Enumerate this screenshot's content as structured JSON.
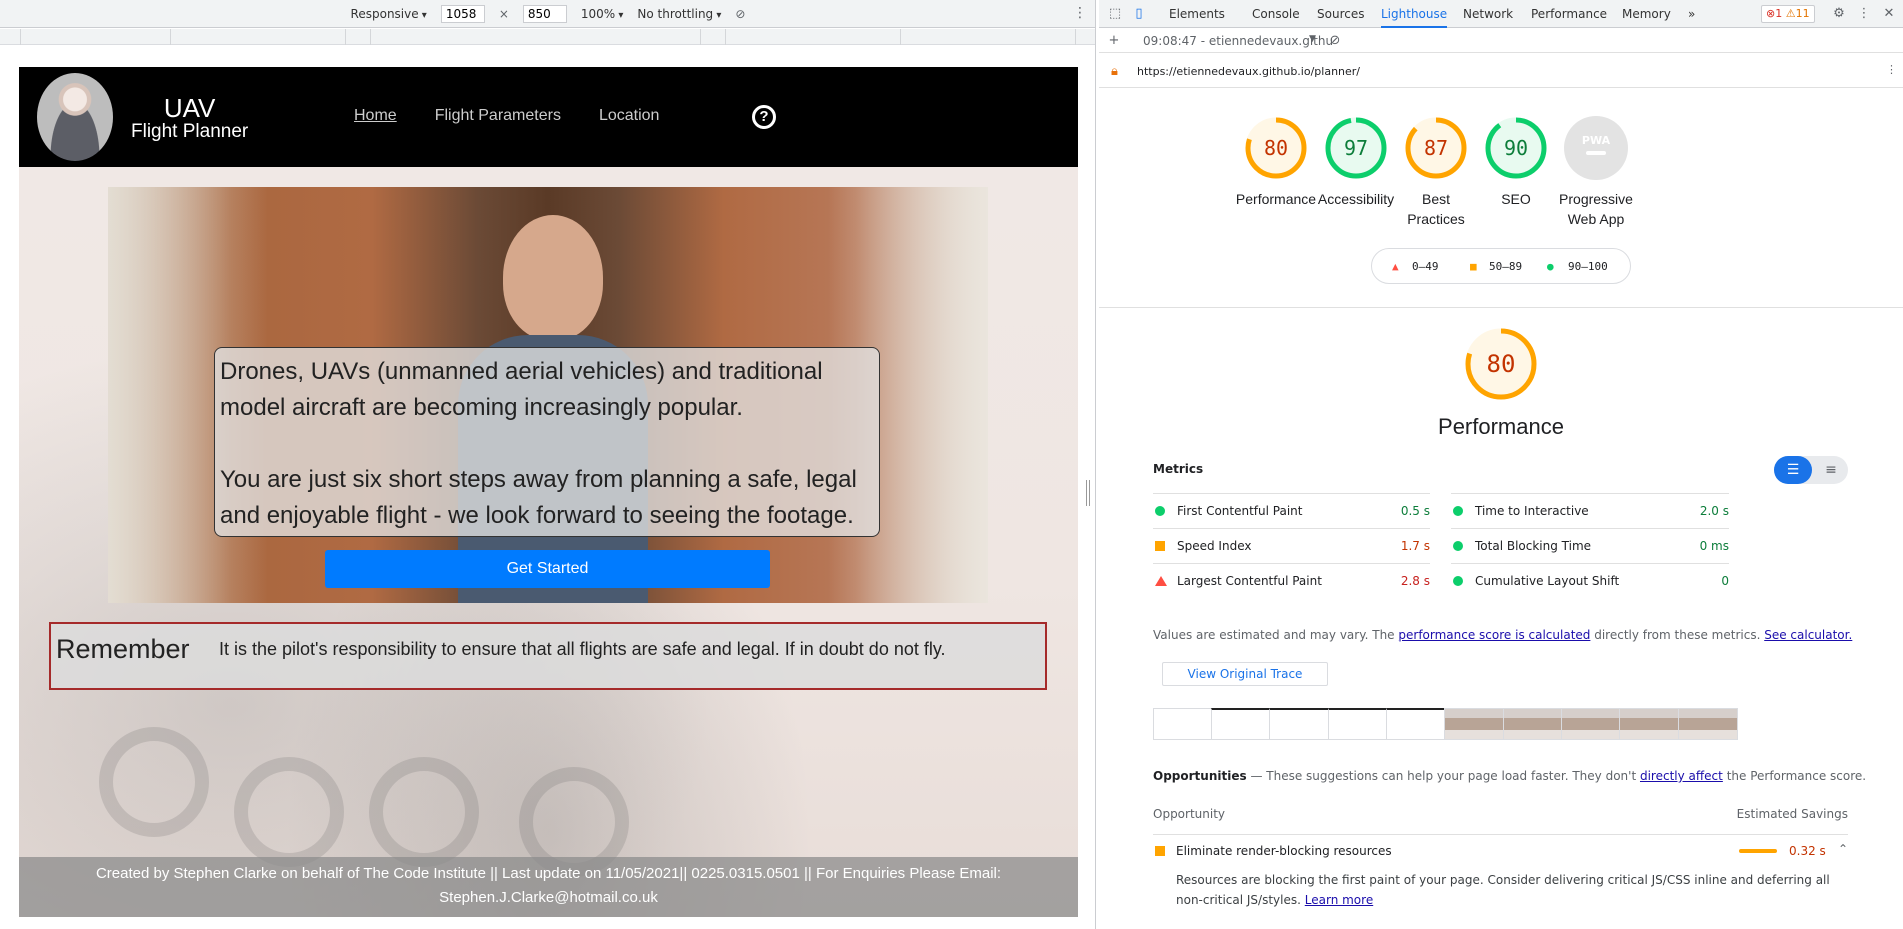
{
  "device_toolbar": {
    "device": "Responsive",
    "width": "1058",
    "height": "850",
    "zoom": "100%",
    "throttling": "No throttling",
    "times": "×"
  },
  "site": {
    "brand_line1": "UAV",
    "brand_line2": "Flight Planner",
    "nav": [
      "Home",
      "Flight Parameters",
      "Location"
    ],
    "intro_p1": "Drones, UAVs (unmanned aerial vehicles) and traditional model aircraft are becoming increasingly popular.",
    "intro_p2": "You are just six short steps away from planning a safe, legal and enjoyable flight - we look forward to seeing the footage.",
    "cta": "Get Started",
    "remember_title": "Remember",
    "remember_text": "It is the pilot's responsibility to ensure that all flights are safe and legal. If in doubt do not fly.",
    "footer": "Created by Stephen Clarke on behalf of The Code Institute || Last update on 11/05/2021|| 0225.0315.0501 || For Enquiries Please Email: Stephen.J.Clarke@hotmail.co.uk"
  },
  "devtools": {
    "tabs": [
      "Elements",
      "Console",
      "Sources",
      "Lighthouse",
      "Network",
      "Performance",
      "Memory"
    ],
    "selected_tab": "Lighthouse",
    "more_tabs": "»",
    "errors": "1",
    "warnings": "11",
    "report_selector": "09:08:47 - etiennedevaux.githu",
    "url": "https://etiennedevaux.github.io/planner/",
    "scores": [
      {
        "label": "Performance",
        "value": "80",
        "fraction": 0.8,
        "color": "#ffa400"
      },
      {
        "label": "Accessibility",
        "value": "97",
        "fraction": 0.97,
        "color": "#0cce6b"
      },
      {
        "label": "Best Practices",
        "value": "87",
        "fraction": 0.87,
        "color": "#ffa400"
      },
      {
        "label": "SEO",
        "value": "90",
        "fraction": 0.9,
        "color": "#0cce6b"
      },
      {
        "label": "Progressive Web App",
        "value": "PWA",
        "fraction": 0,
        "color": "#bdbdbd"
      }
    ],
    "legend": [
      "0–49",
      "50–89",
      "90–100"
    ],
    "performance": {
      "score": "80",
      "title": "Performance",
      "metrics_heading": "Metrics",
      "metrics": [
        {
          "name": "First Contentful Paint",
          "value": "0.5 s",
          "status": "green"
        },
        {
          "name": "Time to Interactive",
          "value": "2.0 s",
          "status": "green"
        },
        {
          "name": "Speed Index",
          "value": "1.7 s",
          "status": "orange"
        },
        {
          "name": "Total Blocking Time",
          "value": "0 ms",
          "status": "green"
        },
        {
          "name": "Largest Contentful Paint",
          "value": "2.8 s",
          "status": "red"
        },
        {
          "name": "Cumulative Layout Shift",
          "value": "0",
          "status": "green"
        }
      ],
      "note_pre": "Values are estimated and may vary. The",
      "note_link1": "performance score is calculated",
      "note_mid": "directly from these metrics.",
      "note_link2": "See calculator.",
      "view_trace": "View Original Trace"
    },
    "opportunities": {
      "heading": "Opportunities",
      "heading_rest": "— These suggestions can help your page load faster. They don't",
      "heading_link": "directly affect",
      "heading_end": "the Performance score.",
      "col_opportunity": "Opportunity",
      "col_savings": "Estimated Savings",
      "item_name": "Eliminate render-blocking resources",
      "item_value": "0.32 s",
      "item_desc": "Resources are blocking the first paint of your page. Consider delivering critical JS/CSS inline and deferring all non-critical JS/styles.",
      "learn_more": "Learn more"
    }
  }
}
